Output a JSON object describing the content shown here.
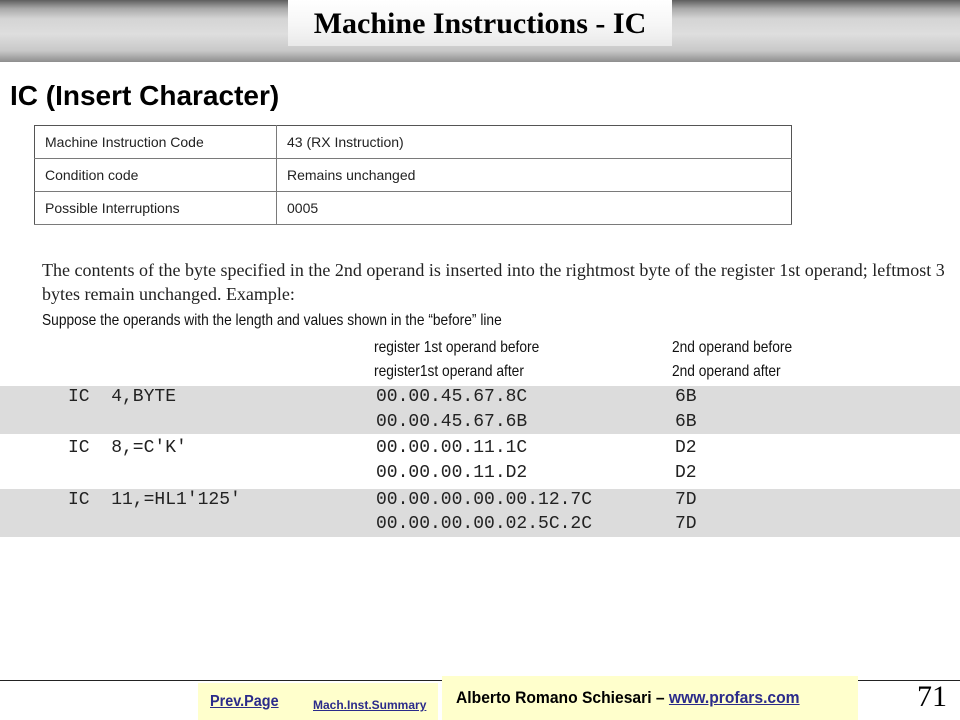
{
  "header": {
    "title": "Machine Instructions - IC"
  },
  "heading": "IC (Insert Character)",
  "info_table": [
    {
      "label": "Machine Instruction Code",
      "value": "43 (RX Instruction)"
    },
    {
      "label": "Condition code",
      "value": "Remains unchanged"
    },
    {
      "label": "Possible Interruptions",
      "value": "0005"
    }
  ],
  "description": "The contents of the byte specified in the 2nd operand is inserted into the rightmost byte of the register 1st operand; leftmost 3 bytes remain unchanged. Example:",
  "suppose": "Suppose the operands with the length and values shown in the “before” line",
  "columns": {
    "before_reg": "register 1st  operand before",
    "before_op2": "2nd operand before",
    "after_reg": "register1st  operand after",
    "after_op2": "2nd operand after"
  },
  "examples": [
    {
      "instr": "IC  4,BYTE",
      "reg_before": "00.00.45.67.8C",
      "op2_before": "6B",
      "reg_after": "00.00.45.67.6B",
      "op2_after": "6B"
    },
    {
      "instr": "IC  8,=C'K'",
      "reg_before": "00.00.00.11.1C",
      "op2_before": "D2",
      "reg_after": "00.00.00.11.D2",
      "op2_after": "D2"
    },
    {
      "instr": "IC  11,=HL1'125'",
      "reg_before": "00.00.00.00.00.12.7C",
      "op2_before": "7D",
      "reg_after": "00.00.00.00.02.5C.2C",
      "op2_after": "7D"
    }
  ],
  "footer": {
    "prev_page": "Prev.Page",
    "summary": "Mach.Inst.Summary",
    "author": "Alberto Romano Schiesari – ",
    "website": "www.profars.com",
    "page_number": "71"
  }
}
